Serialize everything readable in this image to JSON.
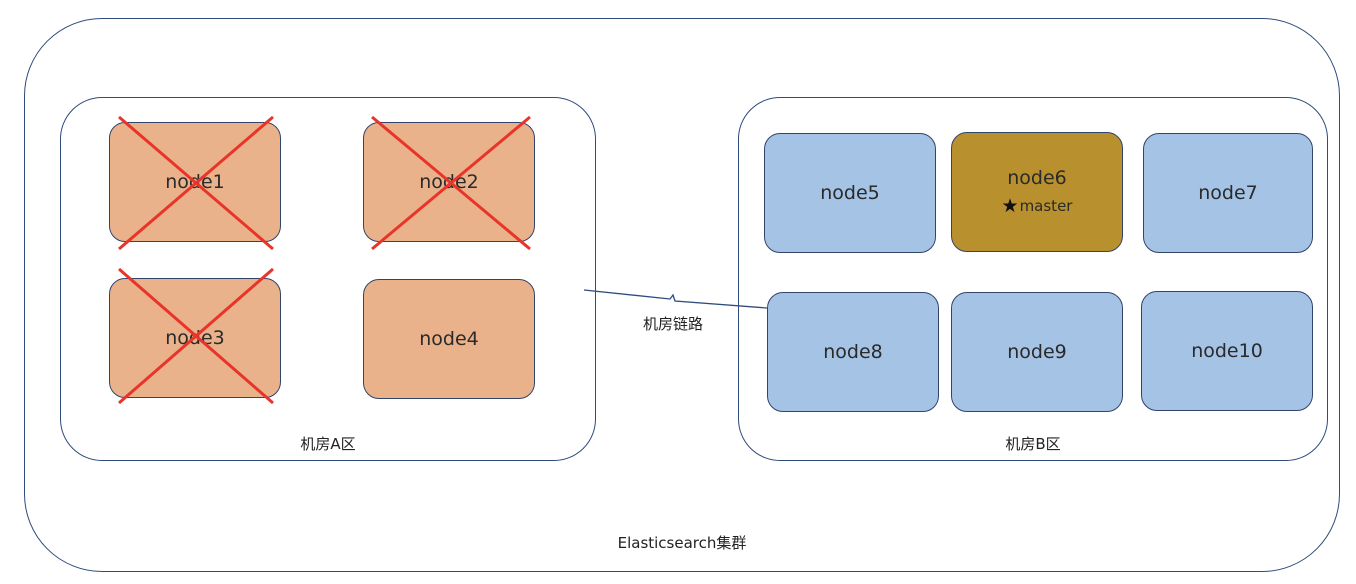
{
  "cluster": {
    "label": "Elasticsearch集群"
  },
  "rooms": {
    "a": {
      "label": "机房A区"
    },
    "b": {
      "label": "机房B区"
    }
  },
  "link": {
    "label": "机房链路"
  },
  "nodes": {
    "node1": {
      "label": "node1",
      "status": "failed"
    },
    "node2": {
      "label": "node2",
      "status": "failed"
    },
    "node3": {
      "label": "node3",
      "status": "failed"
    },
    "node4": {
      "label": "node4",
      "status": "ok"
    },
    "node5": {
      "label": "node5",
      "status": "ok"
    },
    "node6": {
      "label": "node6",
      "status": "ok",
      "role": "master"
    },
    "node7": {
      "label": "node7",
      "status": "ok"
    },
    "node8": {
      "label": "node8",
      "status": "ok"
    },
    "node9": {
      "label": "node9",
      "status": "ok"
    },
    "node10": {
      "label": "node10",
      "status": "ok"
    }
  },
  "master_icon": "★",
  "colors": {
    "room_a_node": "#eab28a",
    "room_b_node": "#a5c3e4",
    "master_node": "#b8902e",
    "failure_cross": "#e8342a",
    "outline": "#2f4b7c"
  }
}
